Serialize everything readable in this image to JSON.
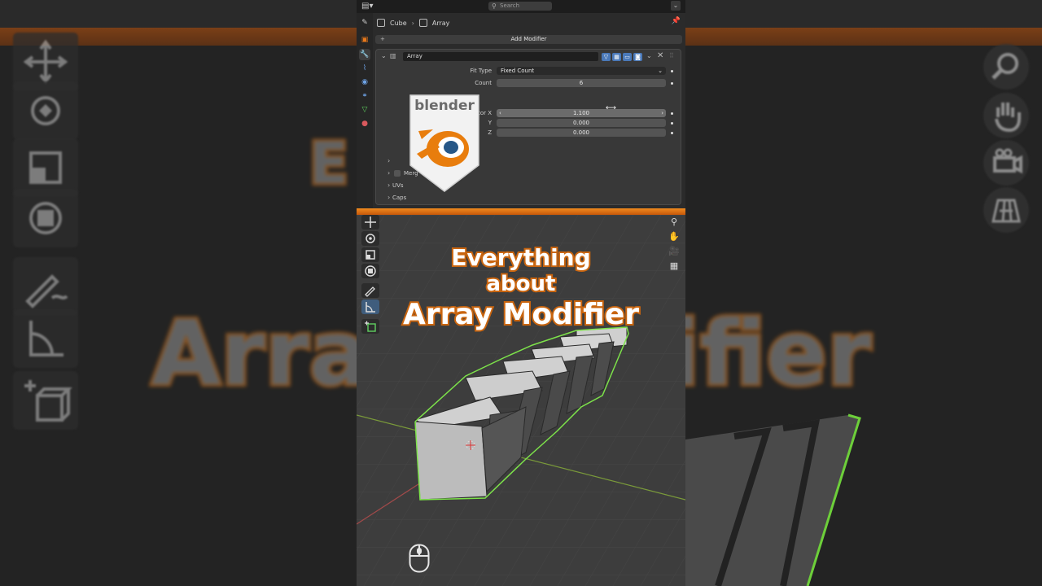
{
  "header": {
    "search_placeholder": "Search"
  },
  "breadcrumb": {
    "object": "Cube",
    "modifier": "Array"
  },
  "add_modifier_label": "Add Modifier",
  "modifier": {
    "name": "Array",
    "fit_type_label": "Fit Type",
    "fit_type_value": "Fixed Count",
    "count_label": "Count",
    "count_value": "6",
    "factor_x_label": "Factor X",
    "factor_x_value": "1.100",
    "y_label": "Y",
    "y_value": "0.000",
    "z_label": "Z",
    "z_value": "0.000",
    "subpanels": [
      "Merg",
      "UVs",
      "Caps"
    ]
  },
  "logo_text": "blender",
  "overlay_title": {
    "line1": "Everything",
    "line2": "about",
    "line3": "Array Modifier"
  },
  "background": {
    "left_text": "Arra",
    "right_text": "ifier"
  },
  "colors": {
    "accent_orange": "#e8781a",
    "selection_outline": "#7de34a",
    "header_bg": "#1d1d1d"
  },
  "icons": [
    "editor-type-icon",
    "search-icon",
    "pin-icon",
    "tool-tab-icon",
    "object-tab-icon",
    "modifier-tab-icon",
    "particles-tab-icon",
    "physics-tab-icon",
    "constraints-tab-icon",
    "data-tab-icon",
    "material-tab-icon",
    "zoom-icon",
    "pan-hand-icon",
    "camera-icon",
    "grid-icon",
    "mouse-icon"
  ]
}
